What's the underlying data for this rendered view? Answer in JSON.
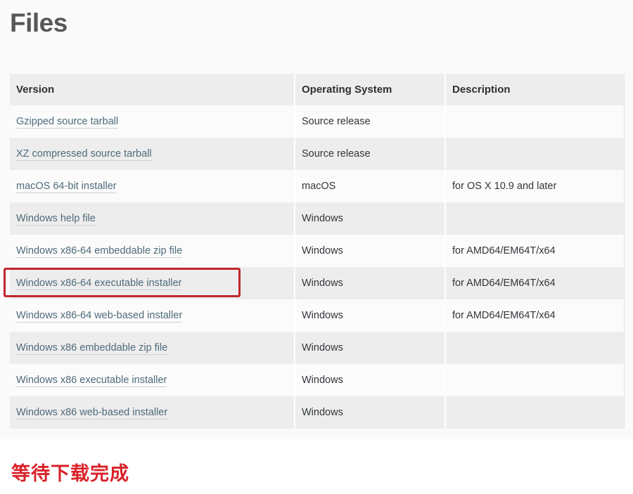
{
  "page": {
    "title": "Files",
    "background_color": "#fafafa",
    "heading_color": "#575757"
  },
  "table": {
    "columns": [
      "Version",
      "Operating System",
      "Description"
    ],
    "header_bg": "#ededed",
    "link_color": "#4e6b7a",
    "rows": [
      {
        "version": "Gzipped source tarball",
        "os": "Source release",
        "description": "",
        "is_link": true,
        "highlighted": false
      },
      {
        "version": "XZ compressed source tarball",
        "os": "Source release",
        "description": "",
        "is_link": true,
        "highlighted": false
      },
      {
        "version": "macOS 64-bit installer",
        "os": "macOS",
        "description": "for OS X 10.9 and later",
        "is_link": true,
        "highlighted": false
      },
      {
        "version": "Windows help file",
        "os": "Windows",
        "description": "",
        "is_link": true,
        "highlighted": false
      },
      {
        "version": "Windows x86-64 embeddable zip file",
        "os": "Windows",
        "description": "for AMD64/EM64T/x64",
        "is_link": true,
        "highlighted": false
      },
      {
        "version": "Windows x86-64 executable installer",
        "os": "Windows",
        "description": "for AMD64/EM64T/x64",
        "is_link": true,
        "highlighted": true
      },
      {
        "version": "Windows x86-64 web-based installer",
        "os": "Windows",
        "description": "for AMD64/EM64T/x64",
        "is_link": true,
        "highlighted": false
      },
      {
        "version": "Windows x86 embeddable zip file",
        "os": "Windows",
        "description": "",
        "is_link": true,
        "highlighted": false
      },
      {
        "version": "Windows x86 executable installer",
        "os": "Windows",
        "description": "",
        "is_link": true,
        "highlighted": false
      },
      {
        "version": "Windows x86 web-based installer",
        "os": "Windows",
        "description": "",
        "is_link": true,
        "highlighted": false
      }
    ]
  },
  "annotation": {
    "text": "等待下载完成",
    "color": "#d9222a"
  },
  "highlight": {
    "target_row_index": 5,
    "border_color": "#c1272d"
  }
}
